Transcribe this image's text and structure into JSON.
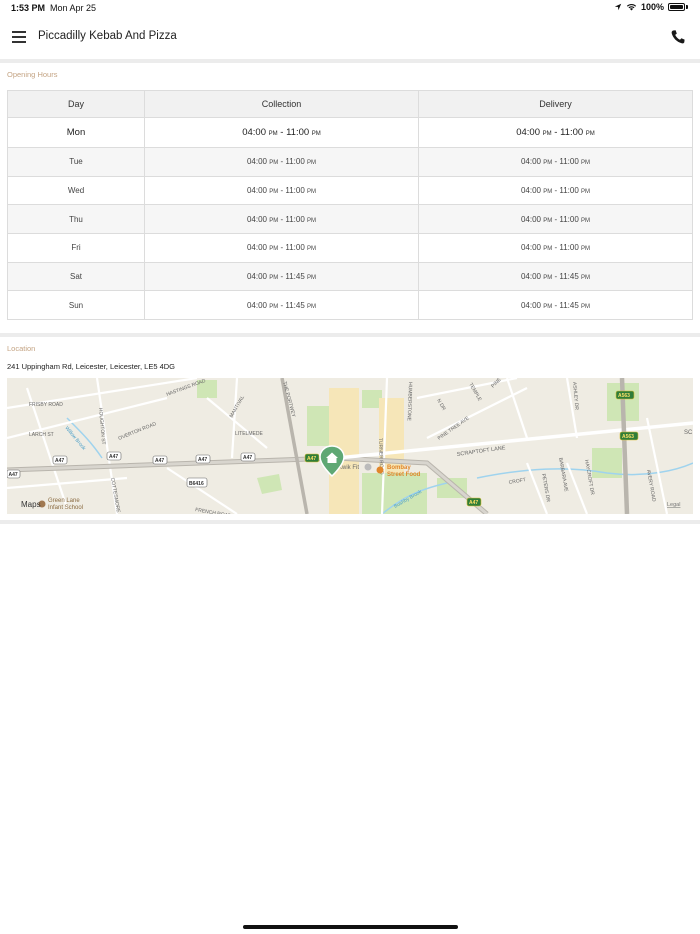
{
  "status": {
    "time": "1:53 PM",
    "date": "Mon Apr 25",
    "battery": "100%"
  },
  "header": {
    "title": "Piccadilly Kebab And Pizza",
    "menu_icon": "hamburger-menu-icon",
    "phone_icon": "phone-icon"
  },
  "opening_hours": {
    "section_label": "Opening Hours",
    "columns": [
      "Day",
      "Collection",
      "Delivery"
    ],
    "rows": [
      {
        "day": "Mon",
        "collection_open": "04:00",
        "collection_close": "11:00",
        "delivery_open": "04:00",
        "delivery_close": "11:00"
      },
      {
        "day": "Tue",
        "collection_open": "04:00",
        "collection_close": "11:00",
        "delivery_open": "04:00",
        "delivery_close": "11:00"
      },
      {
        "day": "Wed",
        "collection_open": "04:00",
        "collection_close": "11:00",
        "delivery_open": "04:00",
        "delivery_close": "11:00"
      },
      {
        "day": "Thu",
        "collection_open": "04:00",
        "collection_close": "11:00",
        "delivery_open": "04:00",
        "delivery_close": "11:00"
      },
      {
        "day": "Fri",
        "collection_open": "04:00",
        "collection_close": "11:00",
        "delivery_open": "04:00",
        "delivery_close": "11:00"
      },
      {
        "day": "Sat",
        "collection_open": "04:00",
        "collection_close": "11:45",
        "delivery_open": "04:00",
        "delivery_close": "11:45"
      },
      {
        "day": "Sun",
        "collection_open": "04:00",
        "collection_close": "11:45",
        "delivery_open": "04:00",
        "delivery_close": "11:45"
      }
    ],
    "pm_label": "PM",
    "separator": "-"
  },
  "location": {
    "section_label": "Location",
    "address": "241 Uppingham Rd, Leicester, Leicester, LE5 4DG",
    "map": {
      "attribution": "Maps",
      "legal": "Legal",
      "streets": [
        "FRISBY ROAD",
        "HASTINGS ROAD",
        "OVERTON ROAD",
        "HOUGHTON ST",
        "LARCH ST",
        "Willow Brook",
        "COTTESMORE",
        "FRENCH ROAD",
        "MANTIVAL",
        "LITELMEDE",
        "THE PORTWEY",
        "HUMBERSTONE",
        "TURNER ROAD",
        "PINE TREE AVE",
        "SCRAPTOFT LANE",
        "N DR",
        "TEMPLE",
        "PINE TREE",
        "ASHLEY DR",
        "BARBARA AVE",
        "HAYCROFT DR",
        "PETERS DR",
        "AVERY ROAD",
        "CROFT",
        "Bushby Brook",
        "SC"
      ],
      "road_shields": [
        "A47",
        "A47",
        "A47",
        "A47",
        "A47",
        "A47",
        "A47",
        "B6416",
        "A563",
        "A563"
      ],
      "pois": [
        "Kwik Fit",
        "Bombay Street Food",
        "Green Lane Infant School"
      ],
      "colors": {
        "land": "#efece3",
        "park": "#cfe6b5",
        "road": "#ffffff",
        "major_road": "#b9b5ad",
        "water": "#9fd3ee",
        "pin": "#5fa874",
        "shield": "#2f7d3a",
        "poi": "#e0862a"
      }
    }
  }
}
